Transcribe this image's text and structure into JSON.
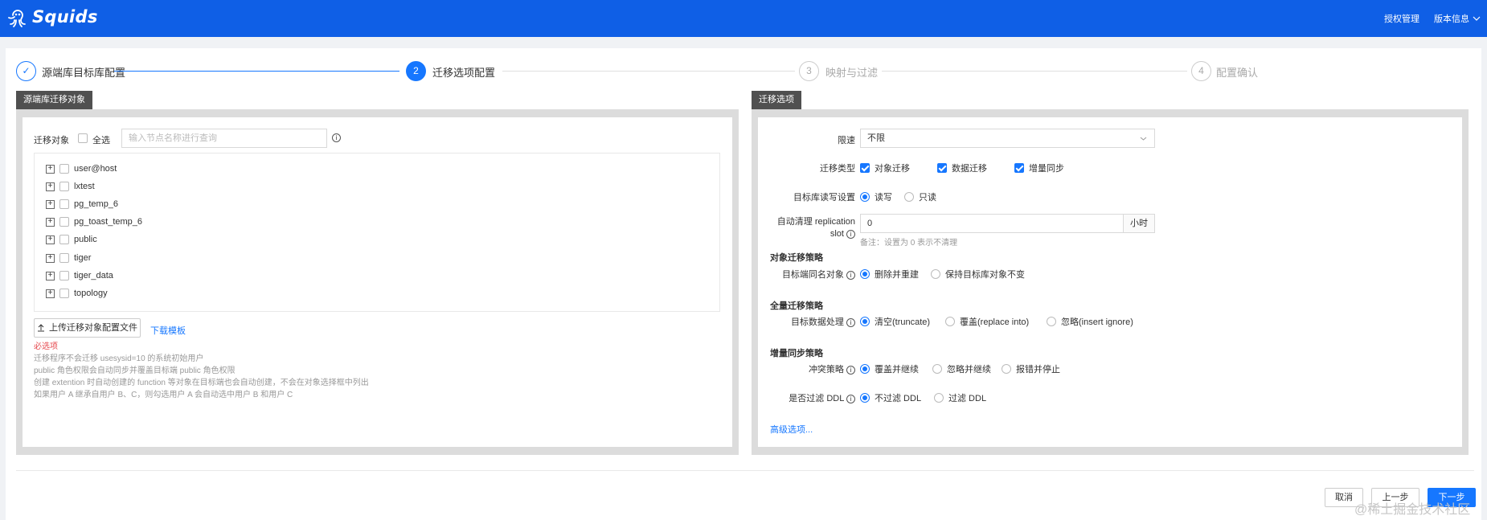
{
  "app": {
    "name": "Squids"
  },
  "topnav": {
    "license": "授权管理",
    "version": "版本信息"
  },
  "steps": [
    {
      "num": "✓",
      "label": "源端库目标库配置"
    },
    {
      "num": "2",
      "label": "迁移选项配置"
    },
    {
      "num": "3",
      "label": "映射与过滤"
    },
    {
      "num": "4",
      "label": "配置确认"
    }
  ],
  "left_panel": {
    "tag": "源端库迁移对象",
    "object_label": "迁移对象",
    "select_all": "全选",
    "search_placeholder": "输入节点名称进行查询",
    "tree": [
      "user@host",
      "lxtest",
      "pg_temp_6",
      "pg_toast_temp_6",
      "public",
      "tiger",
      "tiger_data",
      "topology"
    ],
    "upload_btn": "上传迁移对象配置文件",
    "download_link": "下载模板",
    "required": "必选项",
    "notes": [
      "迁移程序不会迁移 usesysid=10 的系统初始用户",
      "public 角色权限会自动同步并覆盖目标端 public 角色权限",
      "创建 extention 时自动创建的 function 等对象在目标端也会自动创建，不会在对象选择框中列出",
      "如果用户 A 继承自用户 B、C，则勾选用户 A 会自动选中用户 B 和用户 C"
    ]
  },
  "right_panel": {
    "tag": "迁移选项",
    "speed_label": "限速",
    "speed_value": "不限",
    "type_label": "迁移类型",
    "types": [
      "对象迁移",
      "数据迁移",
      "增量同步"
    ],
    "rw_label": "目标库读写设置",
    "rw_options": [
      "读写",
      "只读"
    ],
    "slot_label_1": "自动清理 replication",
    "slot_label_2": "slot",
    "slot_value": "0",
    "slot_unit": "小时",
    "slot_hint": "备注：设置为 0 表示不清理",
    "obj_section": "对象迁移策略",
    "obj_label": "目标端同名对象",
    "obj_options": [
      "删除并重建",
      "保持目标库对象不变"
    ],
    "full_section": "全量迁移策略",
    "full_label": "目标数据处理",
    "full_options": [
      "清空(truncate)",
      "覆盖(replace into)",
      "忽略(insert ignore)"
    ],
    "inc_section": "增量同步策略",
    "conflict_label": "冲突策略",
    "conflict_options": [
      "覆盖并继续",
      "忽略并继续",
      "报错并停止"
    ],
    "ddl_label": "是否过滤 DDL",
    "ddl_options": [
      "不过滤 DDL",
      "过滤 DDL"
    ],
    "advanced": "高级选项..."
  },
  "footer": {
    "cancel": "取消",
    "prev": "上一步",
    "next": "下一步"
  },
  "watermark": "@稀土掘金技术社区",
  "colors": {
    "brand": "#0f5fe6",
    "accent": "#1677ff",
    "panel_tag": "#505050"
  }
}
